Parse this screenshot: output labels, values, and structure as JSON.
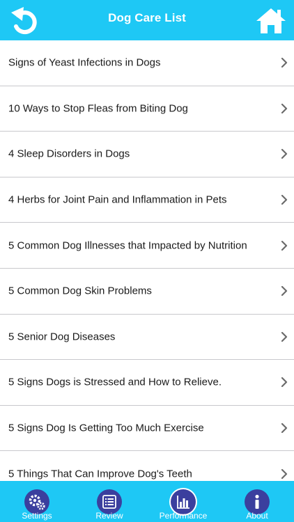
{
  "header": {
    "title": "Dog Care List",
    "back_icon": "back-arrow-icon",
    "home_icon": "home-icon"
  },
  "list": {
    "items": [
      {
        "label": "Signs of Yeast Infections in Dogs"
      },
      {
        "label": "10 Ways to Stop Fleas from Biting Dog"
      },
      {
        "label": "4 Sleep Disorders in Dogs"
      },
      {
        "label": "4 Herbs for Joint Pain and Inflammation in Pets"
      },
      {
        "label": "5 Common Dog Illnesses that Impacted by Nutrition"
      },
      {
        "label": "5 Common Dog Skin Problems"
      },
      {
        "label": "5 Senior Dog Diseases"
      },
      {
        "label": "5 Signs Dogs is Stressed and How to Relieve."
      },
      {
        "label": "5 Signs Dog Is Getting Too Much Exercise"
      },
      {
        "label": "5 Things That Can Improve Dog's Teeth"
      }
    ]
  },
  "tabbar": {
    "tabs": [
      {
        "label": "Settings",
        "icon": "gears-icon"
      },
      {
        "label": "Review",
        "icon": "list-icon"
      },
      {
        "label": "Performance",
        "icon": "bar-chart-icon",
        "selected": true
      },
      {
        "label": "About",
        "icon": "info-icon"
      }
    ]
  },
  "colors": {
    "accent": "#1ec8f5",
    "tab_icon_bg": "#3b3f9e",
    "divider": "#c8c8cc",
    "text": "#1a1a1a",
    "chevron": "#6b6b6b"
  }
}
